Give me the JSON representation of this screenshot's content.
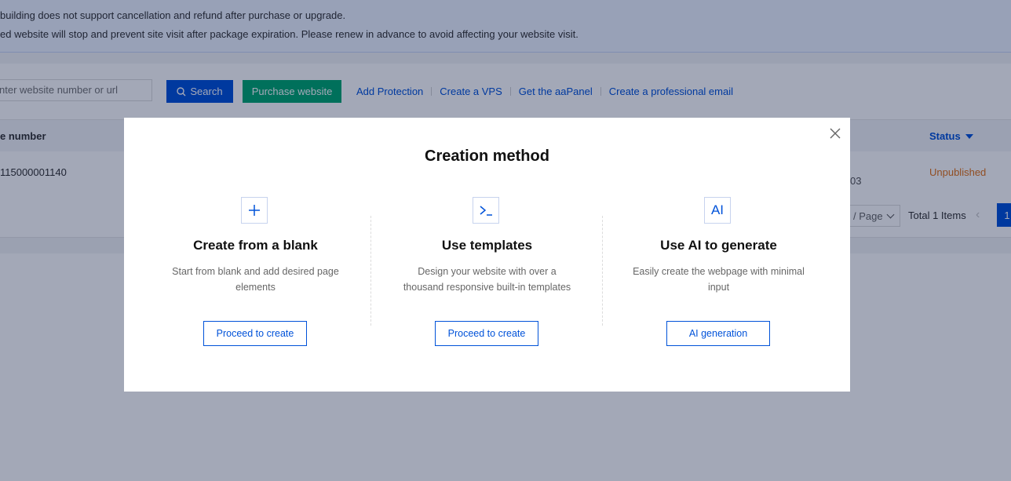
{
  "notice": {
    "line1": " building does not support cancellation and refund after purchase or upgrade.",
    "line2": "ed website will stop and prevent site visit after package expiration. Please renew in advance to avoid affecting your website visit."
  },
  "toolbar": {
    "search_placeholder": "nter website number or url",
    "search_label": "Search",
    "purchase_label": "Purchase website",
    "links": [
      "Add Protection",
      "Create a VPS",
      "Get the aaPanel",
      "Create a professional email"
    ]
  },
  "table": {
    "headers": {
      "number": "e number",
      "status": "Status"
    },
    "rows": [
      {
        "number": "115000001140",
        "fragment": "03",
        "status": "Unpublished"
      }
    ]
  },
  "pagination": {
    "page_size": "/ Page",
    "total": "Total 1 Items",
    "current_page": "1"
  },
  "modal": {
    "title": "Creation method",
    "options": [
      {
        "icon": "plus-icon",
        "icon_text": "+",
        "title": "Create from a blank",
        "description": "Start from blank and add desired page elements",
        "button": "Proceed to create"
      },
      {
        "icon": "terminal-icon",
        "icon_text": ">_",
        "title": "Use templates",
        "description": "Design your website with over a thousand responsive built-in templates",
        "button": "Proceed to create"
      },
      {
        "icon": "ai-icon",
        "icon_text": "AI",
        "title": "Use AI to generate",
        "description": "Easily create the webpage with minimal input",
        "button": "AI generation"
      }
    ]
  },
  "colors": {
    "primary": "#0052d9",
    "success": "#00a870",
    "warning": "#e37318"
  }
}
